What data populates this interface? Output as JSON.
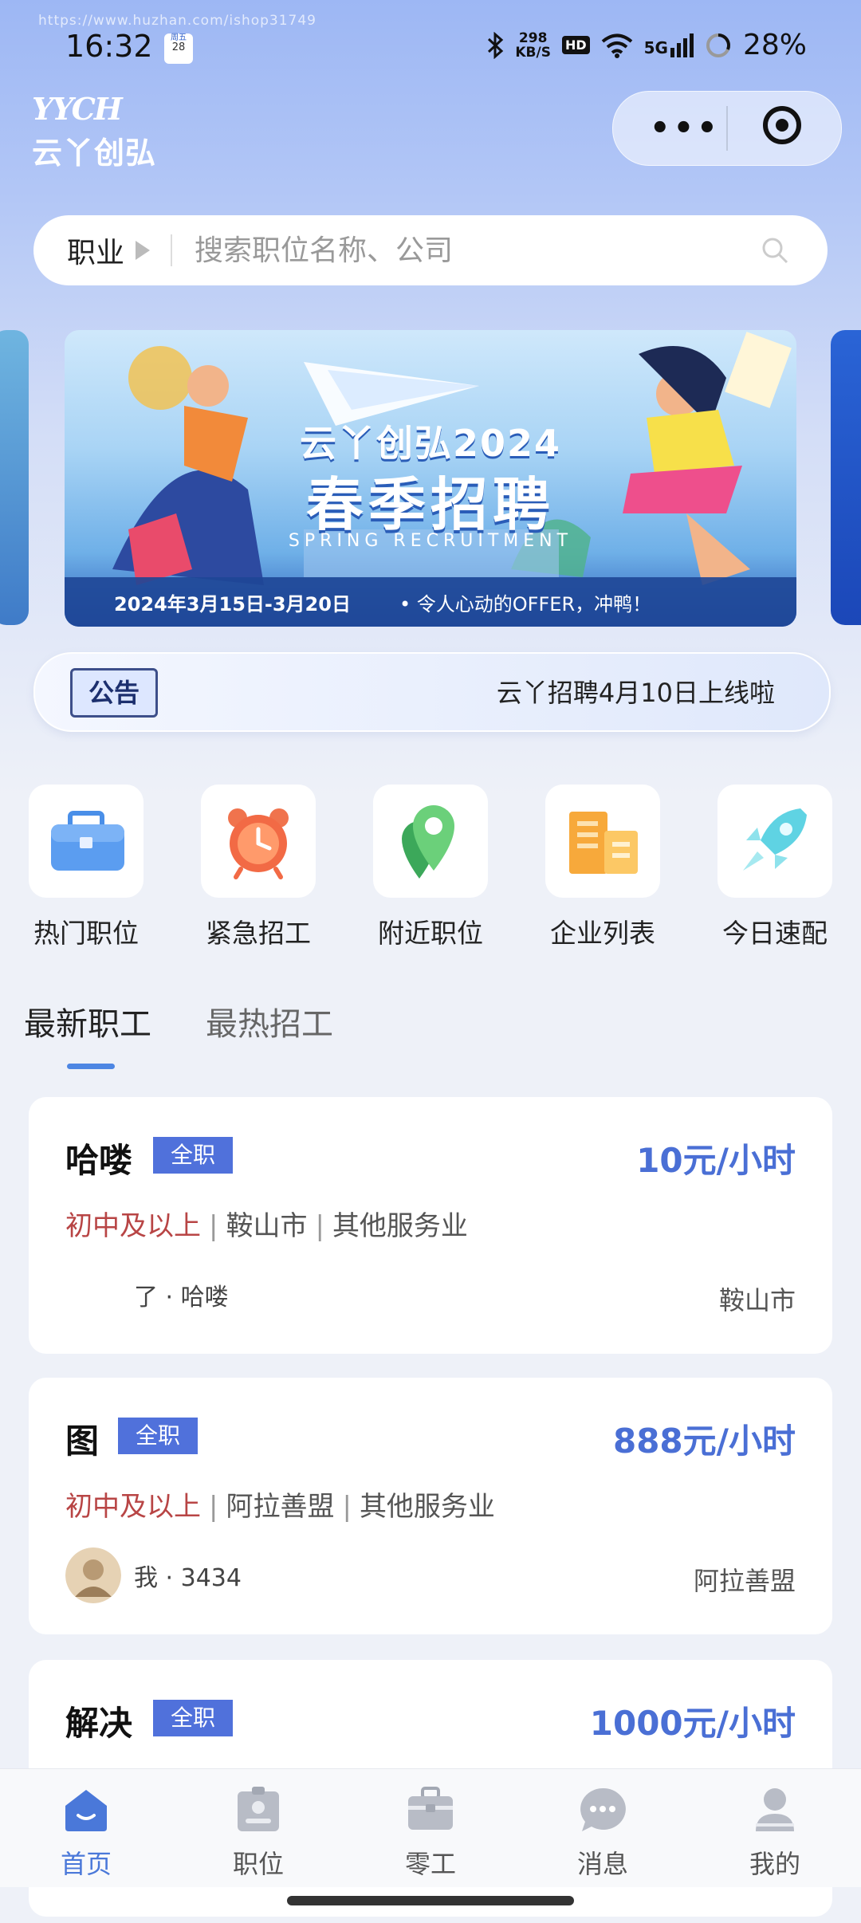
{
  "status_bar": {
    "watermark": "https://www.huzhan.com/ishop31749",
    "time": "16:32",
    "calendar_weekday": "周五",
    "calendar_day": "28",
    "net_speed": "298",
    "net_unit": "KB/S",
    "hd": "HD",
    "signal": "5G",
    "battery": "28%"
  },
  "header": {
    "logo_mark": "YYCH",
    "logo_text": "云丫创弘"
  },
  "search": {
    "category": "职业",
    "placeholder": "搜索职位名称、公司"
  },
  "banner": {
    "line1": "云丫创弘2024",
    "line2": "春季招聘",
    "line3": "SPRING RECRUITMENT",
    "date": "2024年3月15日-3月20日",
    "slogan": "•  令人心动的OFFER，冲鸭！"
  },
  "notice": {
    "tag": "公告",
    "message": "云丫招聘4月10日上线啦"
  },
  "categories": [
    {
      "label": "热门职位",
      "icon": "briefcase-icon"
    },
    {
      "label": "紧急招工",
      "icon": "alarm-clock-icon"
    },
    {
      "label": "附近职位",
      "icon": "location-pin-icon"
    },
    {
      "label": "企业列表",
      "icon": "building-icon"
    },
    {
      "label": "今日速配",
      "icon": "rocket-icon"
    }
  ],
  "tabs": [
    {
      "label": "最新职工",
      "active": true
    },
    {
      "label": "最热招工",
      "active": false
    }
  ],
  "jobs": [
    {
      "title": "哈喽",
      "type": "全职",
      "salary": "10元/小时",
      "education": "初中及以上",
      "city": "鞍山市",
      "industry": "其他服务业",
      "poster": "了 · 哈喽",
      "location": "鞍山市"
    },
    {
      "title": "图",
      "type": "全职",
      "salary": "888元/小时",
      "education": "初中及以上",
      "city": "阿拉善盟",
      "industry": "其他服务业",
      "poster": "我 · 3434",
      "location": "阿拉善盟"
    },
    {
      "title": "解决",
      "type": "全职",
      "salary": "1000元/小时"
    }
  ],
  "bottom_nav": [
    {
      "label": "首页",
      "icon": "home-icon",
      "active": true
    },
    {
      "label": "职位",
      "icon": "id-card-icon",
      "active": false
    },
    {
      "label": "零工",
      "icon": "toolbox-icon",
      "active": false
    },
    {
      "label": "消息",
      "icon": "chat-bubble-icon",
      "active": false
    },
    {
      "label": "我的",
      "icon": "user-icon",
      "active": false
    }
  ],
  "colors": {
    "accent": "#4a78d9",
    "salary": "#4a6fd5",
    "badge": "#5071db",
    "education": "#b84545"
  }
}
